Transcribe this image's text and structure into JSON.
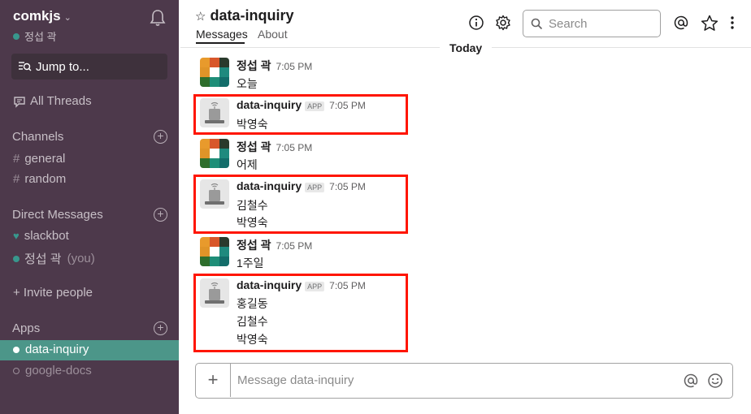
{
  "sidebar": {
    "team_name": "comkjs",
    "team_chevron": "⌄",
    "current_user": "정섭 곽",
    "jump_to": "Jump to...",
    "all_threads": "All Threads",
    "channels_heading": "Channels",
    "channels": [
      {
        "prefix": "#",
        "name": "general"
      },
      {
        "prefix": "#",
        "name": "random"
      }
    ],
    "dm_heading": "Direct Messages",
    "dms": [
      {
        "name": "slackbot",
        "suffix": ""
      },
      {
        "name": "정섭 곽",
        "suffix": "(you)"
      }
    ],
    "invite": "+ Invite people",
    "apps_heading": "Apps",
    "apps": [
      {
        "name": "data-inquiry",
        "active": true
      },
      {
        "name": "google-docs",
        "active": false
      }
    ],
    "plus_glyph": "+"
  },
  "header": {
    "star_glyph": "☆",
    "channel_name": "data-inquiry",
    "tabs": [
      "Messages",
      "About"
    ],
    "search_placeholder": "Search"
  },
  "feed": {
    "day_divider": "Today",
    "messages": [
      {
        "sender": "정섭 곽",
        "is_app": false,
        "time": "7:05 PM",
        "lines": [
          "오늘"
        ]
      },
      {
        "sender": "data-inquiry",
        "is_app": true,
        "app_badge": "APP",
        "time": "7:05 PM",
        "lines": [
          "박영숙"
        ]
      },
      {
        "sender": "정섭 곽",
        "is_app": false,
        "time": "7:05 PM",
        "lines": [
          "어제"
        ]
      },
      {
        "sender": "data-inquiry",
        "is_app": true,
        "app_badge": "APP",
        "time": "7:05 PM",
        "lines": [
          "김철수",
          "박영숙"
        ]
      },
      {
        "sender": "정섭 곽",
        "is_app": false,
        "time": "7:05 PM",
        "lines": [
          "1주일"
        ]
      },
      {
        "sender": "data-inquiry",
        "is_app": true,
        "app_badge": "APP",
        "time": "7:05 PM",
        "lines": [
          "홍길동",
          "김철수",
          "박영숙"
        ]
      }
    ]
  },
  "composer": {
    "plus_glyph": "+",
    "placeholder": "Message data-inquiry"
  },
  "colors": {
    "sidebar_bg": "#4d394b",
    "active_item": "#4c9689",
    "online_green": "#38978d",
    "highlight_red": "#ff1500"
  }
}
